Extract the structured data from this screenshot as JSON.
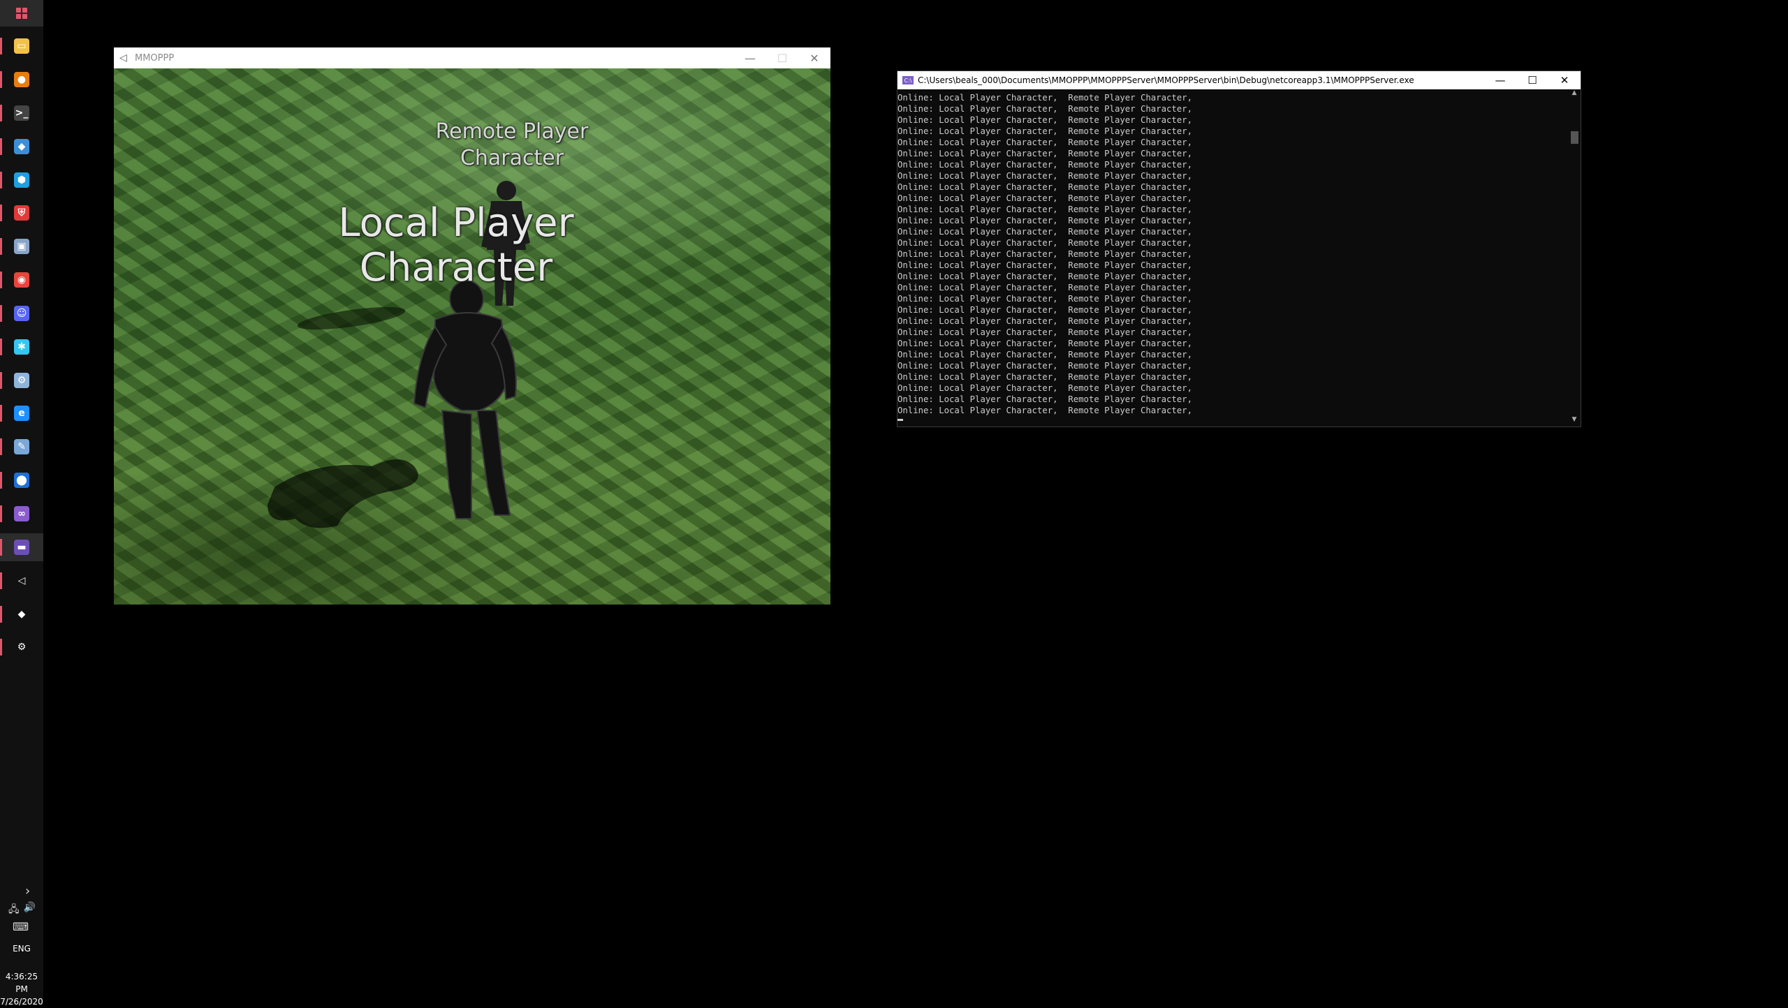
{
  "taskbar": {
    "icons": [
      {
        "name": "start-icon"
      },
      {
        "name": "file-explorer-icon",
        "color": "#f2c14b"
      },
      {
        "name": "blender-icon",
        "color": "#e87d0d"
      },
      {
        "name": "terminal-icon",
        "color": "#444444"
      },
      {
        "name": "paint-icon",
        "color": "#3b8fd9"
      },
      {
        "name": "shield-app-icon",
        "color": "#1ba1e2"
      },
      {
        "name": "security-app-icon",
        "color": "#e03a3a"
      },
      {
        "name": "photos-icon",
        "color": "#8aa4c8"
      },
      {
        "name": "chrome-icon",
        "color": "#e8453c"
      },
      {
        "name": "discord-icon",
        "color": "#5865f2"
      },
      {
        "name": "slack-icon",
        "color": "#36c5f0"
      },
      {
        "name": "steam-icon",
        "color": "#8fb4d9"
      },
      {
        "name": "edge-icon",
        "color": "#1e90ff"
      },
      {
        "name": "notepad-icon",
        "color": "#7aa7d6"
      },
      {
        "name": "maps-icon",
        "color": "#1e6fd9"
      },
      {
        "name": "visual-studio-icon",
        "color": "#8a5cd0"
      },
      {
        "name": "console-app-icon",
        "color": "#6b4fb5"
      },
      {
        "name": "unity-icon",
        "color": "#ffffff"
      },
      {
        "name": "unity-hub-icon",
        "color": "#ffffff"
      },
      {
        "name": "settings-icon",
        "color": "#ffffff"
      }
    ],
    "language": "ENG",
    "time": "4:36:25 PM",
    "date": "7/26/2020"
  },
  "game_window": {
    "title": "MMOPPP",
    "remote_label_line1": "Remote Player",
    "remote_label_line2": "Character",
    "local_label_line1": "Local Player",
    "local_label_line2": "Character"
  },
  "console_window": {
    "title": "C:\\Users\\beals_000\\Documents\\MMOPPP\\MMOPPPServer\\MMOPPPServer\\bin\\Debug\\netcoreapp3.1\\MMOPPPServer.exe",
    "lines": [
      "Online: Local Player Character,  Remote Player Character,",
      "Online: Local Player Character,  Remote Player Character,",
      "Online: Local Player Character,  Remote Player Character,",
      "Online: Local Player Character,  Remote Player Character,",
      "Online: Local Player Character,  Remote Player Character,",
      "Online: Local Player Character,  Remote Player Character,",
      "Online: Local Player Character,  Remote Player Character,",
      "Online: Local Player Character,  Remote Player Character,",
      "Online: Local Player Character,  Remote Player Character,",
      "Online: Local Player Character,  Remote Player Character,",
      "Online: Local Player Character,  Remote Player Character,",
      "Online: Local Player Character,  Remote Player Character,",
      "Online: Local Player Character,  Remote Player Character,",
      "Online: Local Player Character,  Remote Player Character,",
      "Online: Local Player Character,  Remote Player Character,",
      "Online: Local Player Character,  Remote Player Character,",
      "Online: Local Player Character,  Remote Player Character,",
      "Online: Local Player Character,  Remote Player Character,",
      "Online: Local Player Character,  Remote Player Character,",
      "Online: Local Player Character,  Remote Player Character,",
      "Online: Local Player Character,  Remote Player Character,",
      "Online: Local Player Character,  Remote Player Character,",
      "Online: Local Player Character,  Remote Player Character,",
      "Online: Local Player Character,  Remote Player Character,",
      "Online: Local Player Character,  Remote Player Character,",
      "Online: Local Player Character,  Remote Player Character,",
      "Online: Local Player Character,  Remote Player Character,",
      "Online: Local Player Character,  Remote Player Character,",
      "Online: Local Player Character,  Remote Player Character,"
    ]
  }
}
